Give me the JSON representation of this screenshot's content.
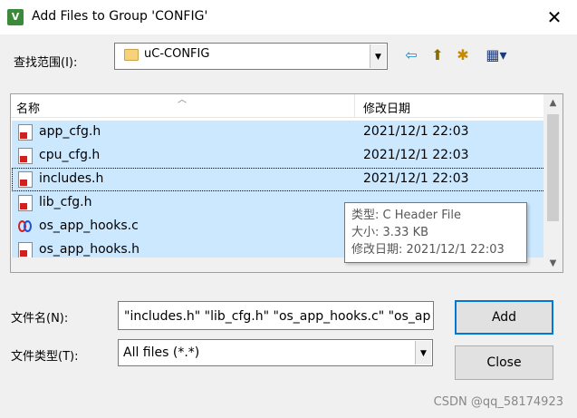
{
  "window": {
    "title": "Add Files to Group 'CONFIG'",
    "app_icon": "keil-app-icon",
    "close_glyph": "✕"
  },
  "lookin": {
    "label": "查找范围(I):",
    "value": "uC-CONFIG"
  },
  "toolbar": {
    "back": "⇦",
    "up": "⬆",
    "new_folder": "✱",
    "view": "▦▾"
  },
  "list": {
    "columns": {
      "name": "名称",
      "date": "修改日期"
    },
    "rows": [
      {
        "name": "app_cfg.h",
        "date": "2021/12/1 22:03",
        "type": "header"
      },
      {
        "name": "cpu_cfg.h",
        "date": "2021/12/1 22:03",
        "type": "header"
      },
      {
        "name": "includes.h",
        "date": "2021/12/1 22:03",
        "type": "header"
      },
      {
        "name": "lib_cfg.h",
        "date": "",
        "type": "header"
      },
      {
        "name": "os_app_hooks.c",
        "date": "",
        "type": "c-source"
      },
      {
        "name": "os_app_hooks.h",
        "date": "",
        "type": "header"
      }
    ]
  },
  "tooltip": {
    "type_line": "类型: C Header File",
    "size_line": "大小: 3.33 KB",
    "date_line": "修改日期: 2021/12/1 22:03"
  },
  "filename": {
    "label": "文件名(N):",
    "value": "\"includes.h\" \"lib_cfg.h\" \"os_app_hooks.c\" \"os_ap"
  },
  "filetype": {
    "label": "文件类型(T):",
    "value": "All files (*.*)"
  },
  "buttons": {
    "add": "Add",
    "close": "Close"
  },
  "watermark": "CSDN @qq_58174923",
  "colors": {
    "selection": "#cce8ff",
    "default_button_border": "#0078d7",
    "header_icon_badge": "#d21f1f"
  }
}
